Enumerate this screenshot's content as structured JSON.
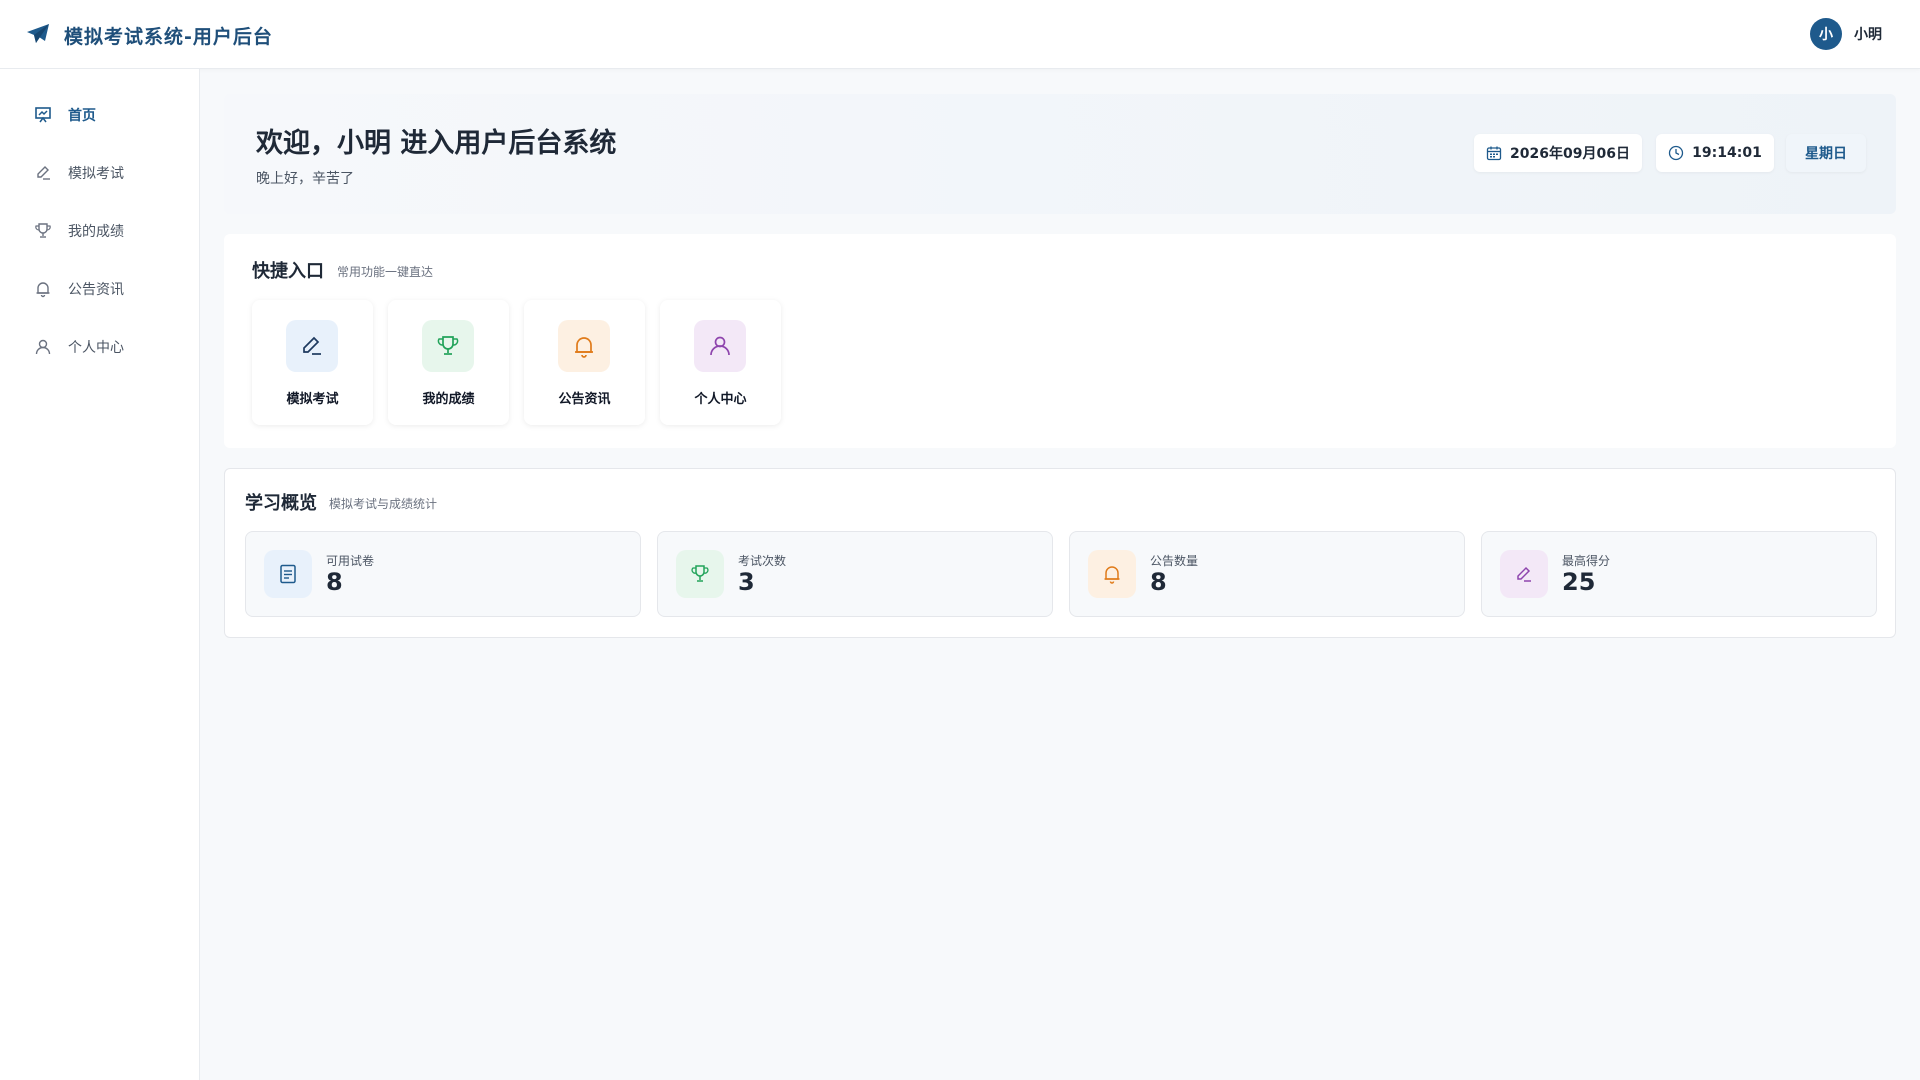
{
  "header": {
    "title": "模拟考试系统-用户后台",
    "user": {
      "avatar_text": "小",
      "name": "小明"
    }
  },
  "sidebar": {
    "items": [
      {
        "label": "首页",
        "icon": "dashboard-icon",
        "active": true
      },
      {
        "label": "模拟考试",
        "icon": "pencil-icon"
      },
      {
        "label": "我的成绩",
        "icon": "trophy-icon"
      },
      {
        "label": "公告资讯",
        "icon": "bell-icon"
      },
      {
        "label": "个人中心",
        "icon": "user-icon"
      }
    ]
  },
  "welcome": {
    "title": "欢迎，小明 进入用户后台系统",
    "subtitle": "晚上好，辛苦了",
    "date": "2026年09月06日",
    "time": "19:14:01",
    "weekday": "星期日"
  },
  "quick": {
    "title": "快捷入口",
    "subtitle": "常用功能一键直达",
    "items": [
      {
        "label": "模拟考试",
        "icon": "pencil-icon",
        "color": "#1e5a8c",
        "bg": "#e8f1fb"
      },
      {
        "label": "我的成绩",
        "icon": "trophy-icon",
        "color": "#22a35a",
        "bg": "#e7f6ec"
      },
      {
        "label": "公告资讯",
        "icon": "bell-icon",
        "color": "#e07b1a",
        "bg": "#fdf0e2"
      },
      {
        "label": "个人中心",
        "icon": "user-icon",
        "color": "#8e44ad",
        "bg": "#f3e8f7"
      }
    ]
  },
  "overview": {
    "title": "学习概览",
    "subtitle": "模拟考试与成绩统计",
    "stats": [
      {
        "label": "可用试卷",
        "value": "8",
        "icon": "document-icon",
        "color": "#1e5a8c",
        "bg": "#e8f1fb"
      },
      {
        "label": "考试次数",
        "value": "3",
        "icon": "trophy-icon",
        "color": "#22a35a",
        "bg": "#e7f6ec"
      },
      {
        "label": "公告数量",
        "value": "8",
        "icon": "bell-icon",
        "color": "#e07b1a",
        "bg": "#fdf0e2"
      },
      {
        "label": "最高得分",
        "value": "25",
        "icon": "pencil-icon",
        "color": "#8e44ad",
        "bg": "#f3e8f7"
      }
    ]
  }
}
